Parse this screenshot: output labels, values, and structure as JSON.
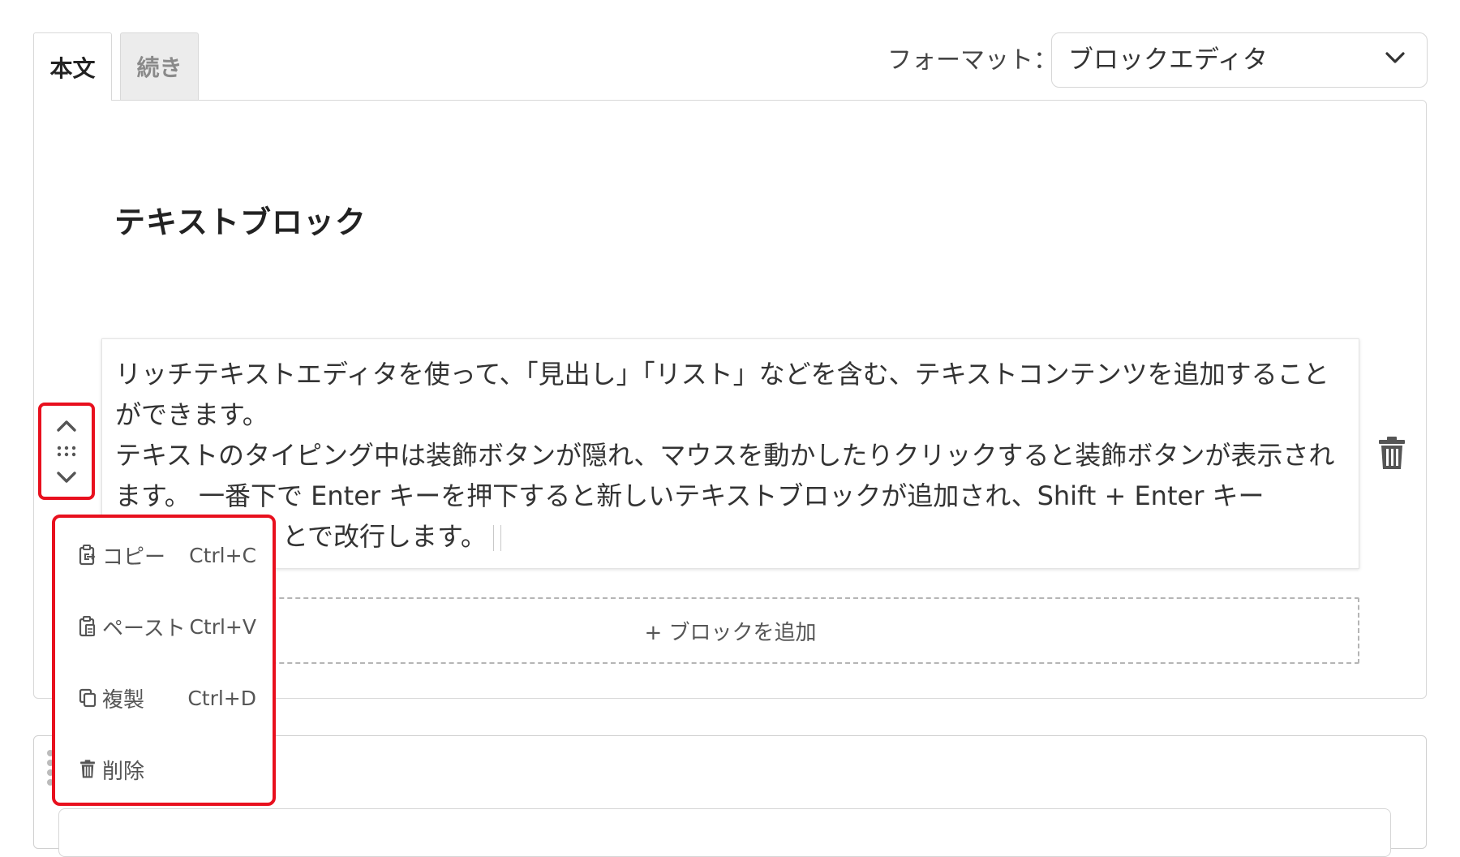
{
  "tabs": [
    {
      "label": "本文",
      "active": true
    },
    {
      "label": "続き",
      "active": false
    }
  ],
  "format": {
    "label": "フォーマット：",
    "value": "ブロックエディタ"
  },
  "editor": {
    "heading": "テキストブロック",
    "paragraph_1": "リッチテキストエディタを使って、「見出し」「リスト」などを含む、テキストコンテンツを追加することができます。",
    "paragraph_2_visible_start": "テキストのタイピング中は装飾ボタンが隠れ、マウスを動かしたりクリックすると装飾ボタンが表示されます。 一番下で Enter キーを押下すると新しいテキストブロックが追加され、Shift + Enter キー",
    "paragraph_2_visible_end": "とで改行します。",
    "add_block_label": "+ ブロックを追加"
  },
  "context_menu": {
    "items": [
      {
        "label": "コピー",
        "shortcut": "Ctrl+C",
        "icon": "copy-icon"
      },
      {
        "label": "ペースト",
        "shortcut": "Ctrl+V",
        "icon": "paste-icon"
      },
      {
        "label": "複製",
        "shortcut": "Ctrl+D",
        "icon": "duplicate-icon"
      },
      {
        "label": "削除",
        "shortcut": "",
        "icon": "trash-icon"
      }
    ]
  },
  "colors": {
    "highlight": "#e8101e",
    "icon": "#555555"
  }
}
